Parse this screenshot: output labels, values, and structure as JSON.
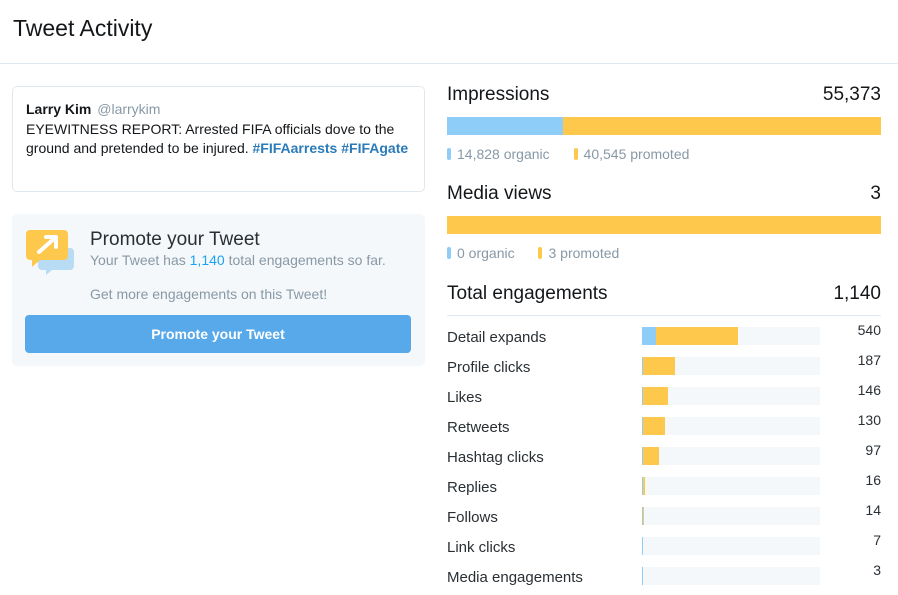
{
  "page": {
    "title": "Tweet Activity"
  },
  "tweet": {
    "author_name": "Larry Kim",
    "author_handle": "@larrykim",
    "text": "EYEWITNESS REPORT: Arrested FIFA officials dove to the ground and pretended to be injured.",
    "hashtags": [
      "#FIFAarrests",
      "#FIFAgate"
    ]
  },
  "promote": {
    "title": "Promote your Tweet",
    "desc_prefix": "Your Tweet has",
    "engagement_count": "1,140",
    "desc_suffix": "total engagements so far.",
    "more": "Get more engagements on this Tweet!",
    "button_label": "Promote your Tweet"
  },
  "impressions": {
    "label": "Impressions",
    "value": "55,373",
    "organic_label": "14,828 organic",
    "promoted_label": "40,545 promoted",
    "organic_fraction": 0.268
  },
  "media_views": {
    "label": "Media views",
    "value": "3",
    "organic_label": "0 organic",
    "promoted_label": "3 promoted",
    "organic_fraction": 0
  },
  "engagements": {
    "label": "Total engagements",
    "value": "1,140",
    "max": 1000,
    "rows": [
      {
        "label": "Detail expands",
        "value": "540",
        "total": 540,
        "organic": 80
      },
      {
        "label": "Profile clicks",
        "value": "187",
        "total": 187,
        "organic": 4
      },
      {
        "label": "Likes",
        "value": "146",
        "total": 146,
        "organic": 4
      },
      {
        "label": "Retweets",
        "value": "130",
        "total": 130,
        "organic": 0
      },
      {
        "label": "Hashtag clicks",
        "value": "97",
        "total": 97,
        "organic": 4
      },
      {
        "label": "Replies",
        "value": "16",
        "total": 16,
        "organic": 0
      },
      {
        "label": "Follows",
        "value": "14",
        "total": 14,
        "organic": 0
      },
      {
        "label": "Link clicks",
        "value": "7",
        "total": 7,
        "organic": 0
      },
      {
        "label": "Media engagements",
        "value": "3",
        "total": 3,
        "organic": 0
      }
    ]
  },
  "colors": {
    "organic": "#8ecdf8",
    "promoted": "#fdc84b",
    "accent": "#58a9ea",
    "hashtag": "#2b7bb9"
  }
}
